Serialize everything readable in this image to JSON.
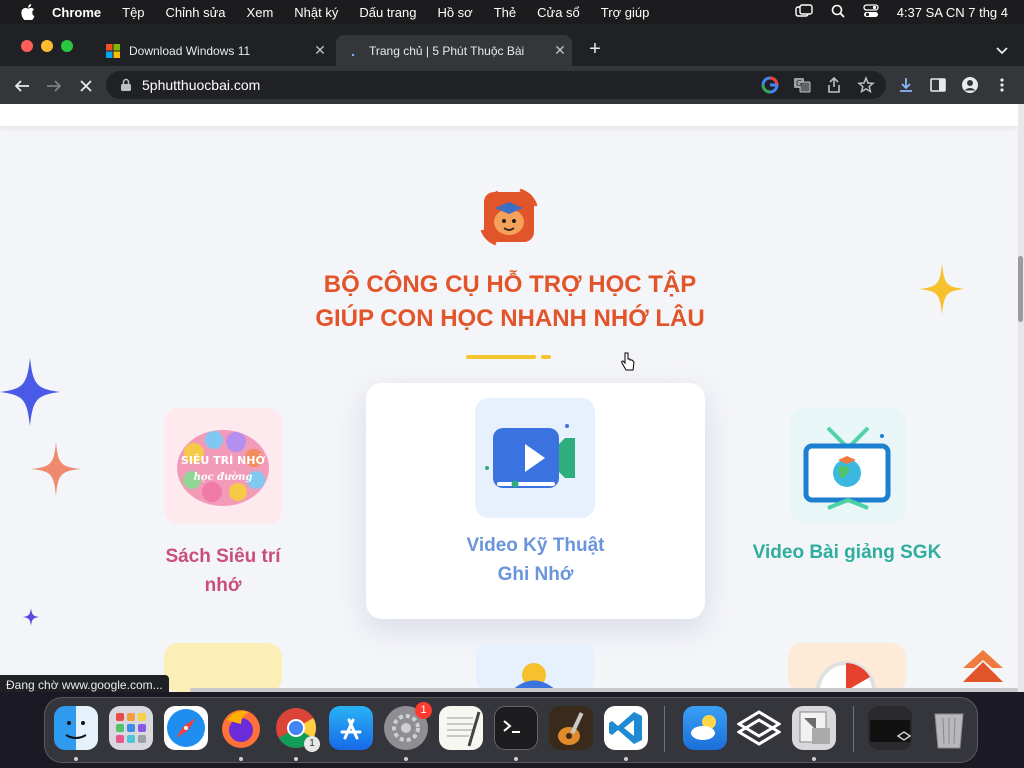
{
  "menubar": {
    "app_name": "Chrome",
    "items": [
      "Tệp",
      "Chỉnh sửa",
      "Xem",
      "Nhật ký",
      "Dấu trang",
      "Hồ sơ",
      "Thẻ",
      "Cửa sổ",
      "Trợ giúp"
    ],
    "clock": "4:37 SA CN 7 thg 4"
  },
  "browser": {
    "tabs": [
      {
        "title": "Download Windows 11"
      },
      {
        "title": "Trang chủ | 5 Phút Thuộc Bài"
      }
    ],
    "url": "5phutthuocbai.com",
    "status_text": "Đang chờ www.google.com..."
  },
  "page": {
    "heading_line1": "BỘ CÔNG CỤ HỖ TRỢ HỌC TẬP",
    "heading_line2": "GIÚP CON HỌC NHANH NHỚ LÂU",
    "cards": [
      {
        "label_line1": "Sách Siêu trí",
        "label_line2": "nhớ",
        "thumb_text_1": "SIÊU TRÍ NHỚ",
        "thumb_text_2": "học đường"
      },
      {
        "label_line1": "Video Kỹ Thuật",
        "label_line2": "Ghi Nhớ"
      },
      {
        "label_line1": "Video Bài giảng SGK"
      }
    ]
  },
  "colors": {
    "heading": "#e2542a",
    "card1_label": "#c94e7e",
    "card2_label": "#6b95db",
    "card3_label": "#2fae9d",
    "accent_yellow": "#f5c52e"
  },
  "dock": {
    "apps": [
      "finder-icon",
      "launchpad-icon",
      "safari-icon",
      "firefox-icon",
      "chrome-icon",
      "app-store-icon",
      "system-settings-icon",
      "textedit-icon",
      "terminal-icon",
      "garageband-icon",
      "vscode-icon",
      "weather-icon",
      "parallels-icon",
      "preview-icon",
      "screen-thumbnail-icon",
      "trash-icon"
    ],
    "settings_badge": "1",
    "chrome_badge": "1"
  }
}
